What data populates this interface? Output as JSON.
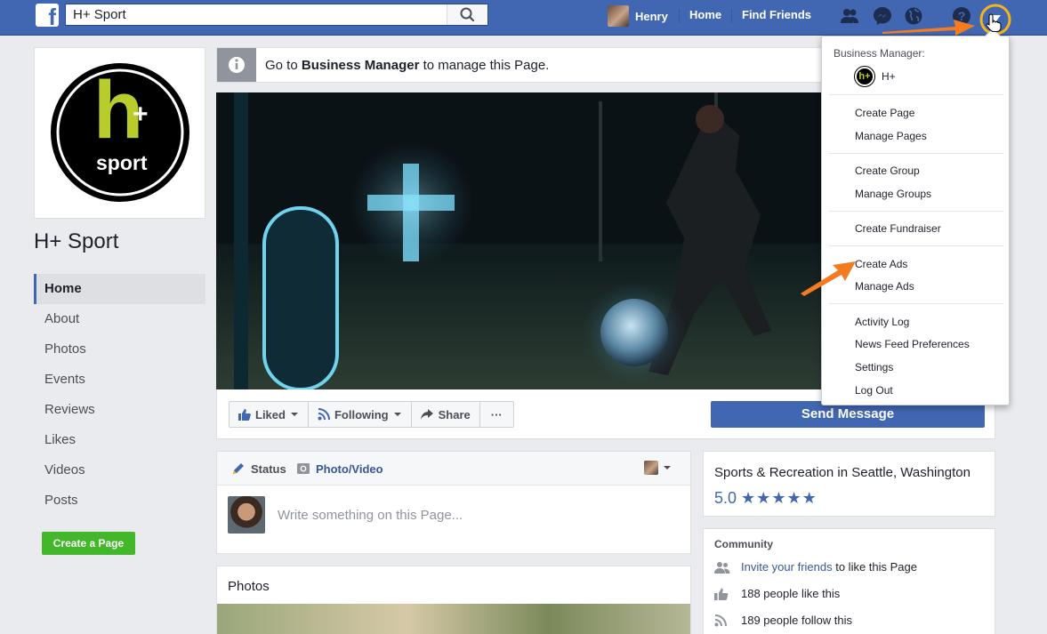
{
  "topbar": {
    "search_value": "H+ Sport",
    "user_name": "Henry",
    "home": "Home",
    "find_friends": "Find Friends"
  },
  "page": {
    "name": "H+ Sport",
    "logo_letter": "h",
    "logo_plus": "+",
    "logo_word": "sport"
  },
  "left_nav": [
    "Home",
    "About",
    "Photos",
    "Events",
    "Reviews",
    "Likes",
    "Videos",
    "Posts"
  ],
  "create_page": "Create a Page",
  "infobar": {
    "prefix": "Go to ",
    "bold": "Business Manager",
    "suffix": " to manage this Page."
  },
  "actions": {
    "liked": "Liked",
    "following": "Following",
    "share": "Share",
    "more": "···",
    "send_message": "Send Message"
  },
  "composer": {
    "status": "Status",
    "photo_video": "Photo/Video",
    "placeholder": "Write something on this Page..."
  },
  "photos_card": {
    "title": "Photos"
  },
  "about": {
    "category": "Sports & Recreation in Seattle, Washington",
    "rating": "5.0",
    "stars": "★★★★★"
  },
  "community": {
    "title": "Community",
    "invite_link": "Invite your friends",
    "invite_suffix": " to like this Page",
    "likes": "188 people like this",
    "follows": "189 people follow this"
  },
  "dropdown": {
    "business_manager_label": "Business Manager:",
    "business_name": "H+",
    "logo_text": "h+",
    "items": [
      "Create Page",
      "Manage Pages",
      "Create Group",
      "Manage Groups",
      "Create Fundraiser",
      "Create Ads",
      "Manage Ads",
      "Activity Log",
      "News Feed Preferences",
      "Settings",
      "Log Out"
    ]
  },
  "colors": {
    "brand_blue": "#4267b2",
    "page_bg": "#e9ebee",
    "green": "#42b72a",
    "annotation_orange": "#f47b20",
    "logo_lime": "#b8cc2c"
  }
}
